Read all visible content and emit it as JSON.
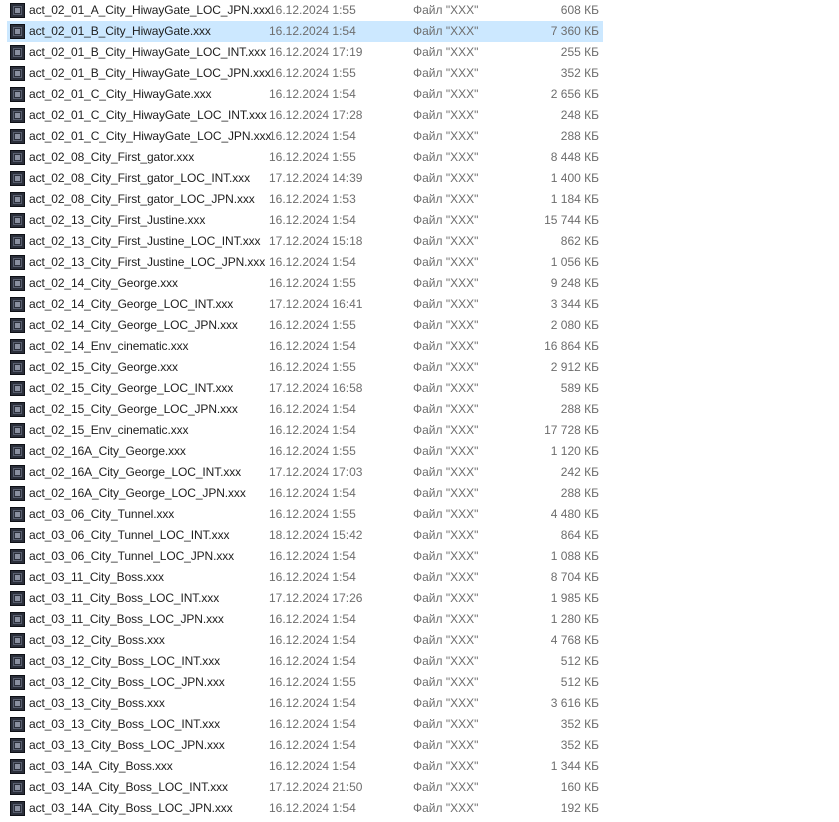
{
  "files": [
    {
      "name": "act_02_01_A_City_HiwayGate_LOC_JPN.xxx",
      "modified": "16.12.2024 1:55",
      "type": "Файл \"XXX\"",
      "size": "608 КБ",
      "selected": false
    },
    {
      "name": "act_02_01_B_City_HiwayGate.xxx",
      "modified": "16.12.2024 1:54",
      "type": "Файл \"XXX\"",
      "size": "7 360 КБ",
      "selected": true
    },
    {
      "name": "act_02_01_B_City_HiwayGate_LOC_INT.xxx",
      "modified": "16.12.2024 17:19",
      "type": "Файл \"XXX\"",
      "size": "255 КБ",
      "selected": false
    },
    {
      "name": "act_02_01_B_City_HiwayGate_LOC_JPN.xxx",
      "modified": "16.12.2024 1:55",
      "type": "Файл \"XXX\"",
      "size": "352 КБ",
      "selected": false
    },
    {
      "name": "act_02_01_C_City_HiwayGate.xxx",
      "modified": "16.12.2024 1:54",
      "type": "Файл \"XXX\"",
      "size": "2 656 КБ",
      "selected": false
    },
    {
      "name": "act_02_01_C_City_HiwayGate_LOC_INT.xxx",
      "modified": "16.12.2024 17:28",
      "type": "Файл \"XXX\"",
      "size": "248 КБ",
      "selected": false
    },
    {
      "name": "act_02_01_C_City_HiwayGate_LOC_JPN.xxx",
      "modified": "16.12.2024 1:54",
      "type": "Файл \"XXX\"",
      "size": "288 КБ",
      "selected": false
    },
    {
      "name": "act_02_08_City_First_gator.xxx",
      "modified": "16.12.2024 1:55",
      "type": "Файл \"XXX\"",
      "size": "8 448 КБ",
      "selected": false
    },
    {
      "name": "act_02_08_City_First_gator_LOC_INT.xxx",
      "modified": "17.12.2024 14:39",
      "type": "Файл \"XXX\"",
      "size": "1 400 КБ",
      "selected": false
    },
    {
      "name": "act_02_08_City_First_gator_LOC_JPN.xxx",
      "modified": "16.12.2024 1:53",
      "type": "Файл \"XXX\"",
      "size": "1 184 КБ",
      "selected": false
    },
    {
      "name": "act_02_13_City_First_Justine.xxx",
      "modified": "16.12.2024 1:54",
      "type": "Файл \"XXX\"",
      "size": "15 744 КБ",
      "selected": false
    },
    {
      "name": "act_02_13_City_First_Justine_LOC_INT.xxx",
      "modified": "17.12.2024 15:18",
      "type": "Файл \"XXX\"",
      "size": "862 КБ",
      "selected": false
    },
    {
      "name": "act_02_13_City_First_Justine_LOC_JPN.xxx",
      "modified": "16.12.2024 1:54",
      "type": "Файл \"XXX\"",
      "size": "1 056 КБ",
      "selected": false
    },
    {
      "name": "act_02_14_City_George.xxx",
      "modified": "16.12.2024 1:55",
      "type": "Файл \"XXX\"",
      "size": "9 248 КБ",
      "selected": false
    },
    {
      "name": "act_02_14_City_George_LOC_INT.xxx",
      "modified": "17.12.2024 16:41",
      "type": "Файл \"XXX\"",
      "size": "3 344 КБ",
      "selected": false
    },
    {
      "name": "act_02_14_City_George_LOC_JPN.xxx",
      "modified": "16.12.2024 1:55",
      "type": "Файл \"XXX\"",
      "size": "2 080 КБ",
      "selected": false
    },
    {
      "name": "act_02_14_Env_cinematic.xxx",
      "modified": "16.12.2024 1:54",
      "type": "Файл \"XXX\"",
      "size": "16 864 КБ",
      "selected": false
    },
    {
      "name": "act_02_15_City_George.xxx",
      "modified": "16.12.2024 1:55",
      "type": "Файл \"XXX\"",
      "size": "2 912 КБ",
      "selected": false
    },
    {
      "name": "act_02_15_City_George_LOC_INT.xxx",
      "modified": "17.12.2024 16:58",
      "type": "Файл \"XXX\"",
      "size": "589 КБ",
      "selected": false
    },
    {
      "name": "act_02_15_City_George_LOC_JPN.xxx",
      "modified": "16.12.2024 1:54",
      "type": "Файл \"XXX\"",
      "size": "288 КБ",
      "selected": false
    },
    {
      "name": "act_02_15_Env_cinematic.xxx",
      "modified": "16.12.2024 1:54",
      "type": "Файл \"XXX\"",
      "size": "17 728 КБ",
      "selected": false
    },
    {
      "name": "act_02_16A_City_George.xxx",
      "modified": "16.12.2024 1:55",
      "type": "Файл \"XXX\"",
      "size": "1 120 КБ",
      "selected": false
    },
    {
      "name": "act_02_16A_City_George_LOC_INT.xxx",
      "modified": "17.12.2024 17:03",
      "type": "Файл \"XXX\"",
      "size": "242 КБ",
      "selected": false
    },
    {
      "name": "act_02_16A_City_George_LOC_JPN.xxx",
      "modified": "16.12.2024 1:54",
      "type": "Файл \"XXX\"",
      "size": "288 КБ",
      "selected": false
    },
    {
      "name": "act_03_06_City_Tunnel.xxx",
      "modified": "16.12.2024 1:55",
      "type": "Файл \"XXX\"",
      "size": "4 480 КБ",
      "selected": false
    },
    {
      "name": "act_03_06_City_Tunnel_LOC_INT.xxx",
      "modified": "18.12.2024 15:42",
      "type": "Файл \"XXX\"",
      "size": "864 КБ",
      "selected": false
    },
    {
      "name": "act_03_06_City_Tunnel_LOC_JPN.xxx",
      "modified": "16.12.2024 1:54",
      "type": "Файл \"XXX\"",
      "size": "1 088 КБ",
      "selected": false
    },
    {
      "name": "act_03_11_City_Boss.xxx",
      "modified": "16.12.2024 1:54",
      "type": "Файл \"XXX\"",
      "size": "8 704 КБ",
      "selected": false
    },
    {
      "name": "act_03_11_City_Boss_LOC_INT.xxx",
      "modified": "17.12.2024 17:26",
      "type": "Файл \"XXX\"",
      "size": "1 985 КБ",
      "selected": false
    },
    {
      "name": "act_03_11_City_Boss_LOC_JPN.xxx",
      "modified": "16.12.2024 1:54",
      "type": "Файл \"XXX\"",
      "size": "1 280 КБ",
      "selected": false
    },
    {
      "name": "act_03_12_City_Boss.xxx",
      "modified": "16.12.2024 1:54",
      "type": "Файл \"XXX\"",
      "size": "4 768 КБ",
      "selected": false
    },
    {
      "name": "act_03_12_City_Boss_LOC_INT.xxx",
      "modified": "16.12.2024 1:54",
      "type": "Файл \"XXX\"",
      "size": "512 КБ",
      "selected": false
    },
    {
      "name": "act_03_12_City_Boss_LOC_JPN.xxx",
      "modified": "16.12.2024 1:55",
      "type": "Файл \"XXX\"",
      "size": "512 КБ",
      "selected": false
    },
    {
      "name": "act_03_13_City_Boss.xxx",
      "modified": "16.12.2024 1:54",
      "type": "Файл \"XXX\"",
      "size": "3 616 КБ",
      "selected": false
    },
    {
      "name": "act_03_13_City_Boss_LOC_INT.xxx",
      "modified": "16.12.2024 1:54",
      "type": "Файл \"XXX\"",
      "size": "352 КБ",
      "selected": false
    },
    {
      "name": "act_03_13_City_Boss_LOC_JPN.xxx",
      "modified": "16.12.2024 1:54",
      "type": "Файл \"XXX\"",
      "size": "352 КБ",
      "selected": false
    },
    {
      "name": "act_03_14A_City_Boss.xxx",
      "modified": "16.12.2024 1:54",
      "type": "Файл \"XXX\"",
      "size": "1 344 КБ",
      "selected": false
    },
    {
      "name": "act_03_14A_City_Boss_LOC_INT.xxx",
      "modified": "17.12.2024 21:50",
      "type": "Файл \"XXX\"",
      "size": "160 КБ",
      "selected": false
    },
    {
      "name": "act_03_14A_City_Boss_LOC_JPN.xxx",
      "modified": "16.12.2024 1:54",
      "type": "Файл \"XXX\"",
      "size": "192 КБ",
      "selected": false
    }
  ],
  "colors": {
    "selection_bg": "#cce8ff",
    "name_text": "#1e1e1e",
    "meta_text": "#6d6d6d",
    "background": "#ffffff"
  },
  "icons": {
    "file": "file-icon"
  }
}
